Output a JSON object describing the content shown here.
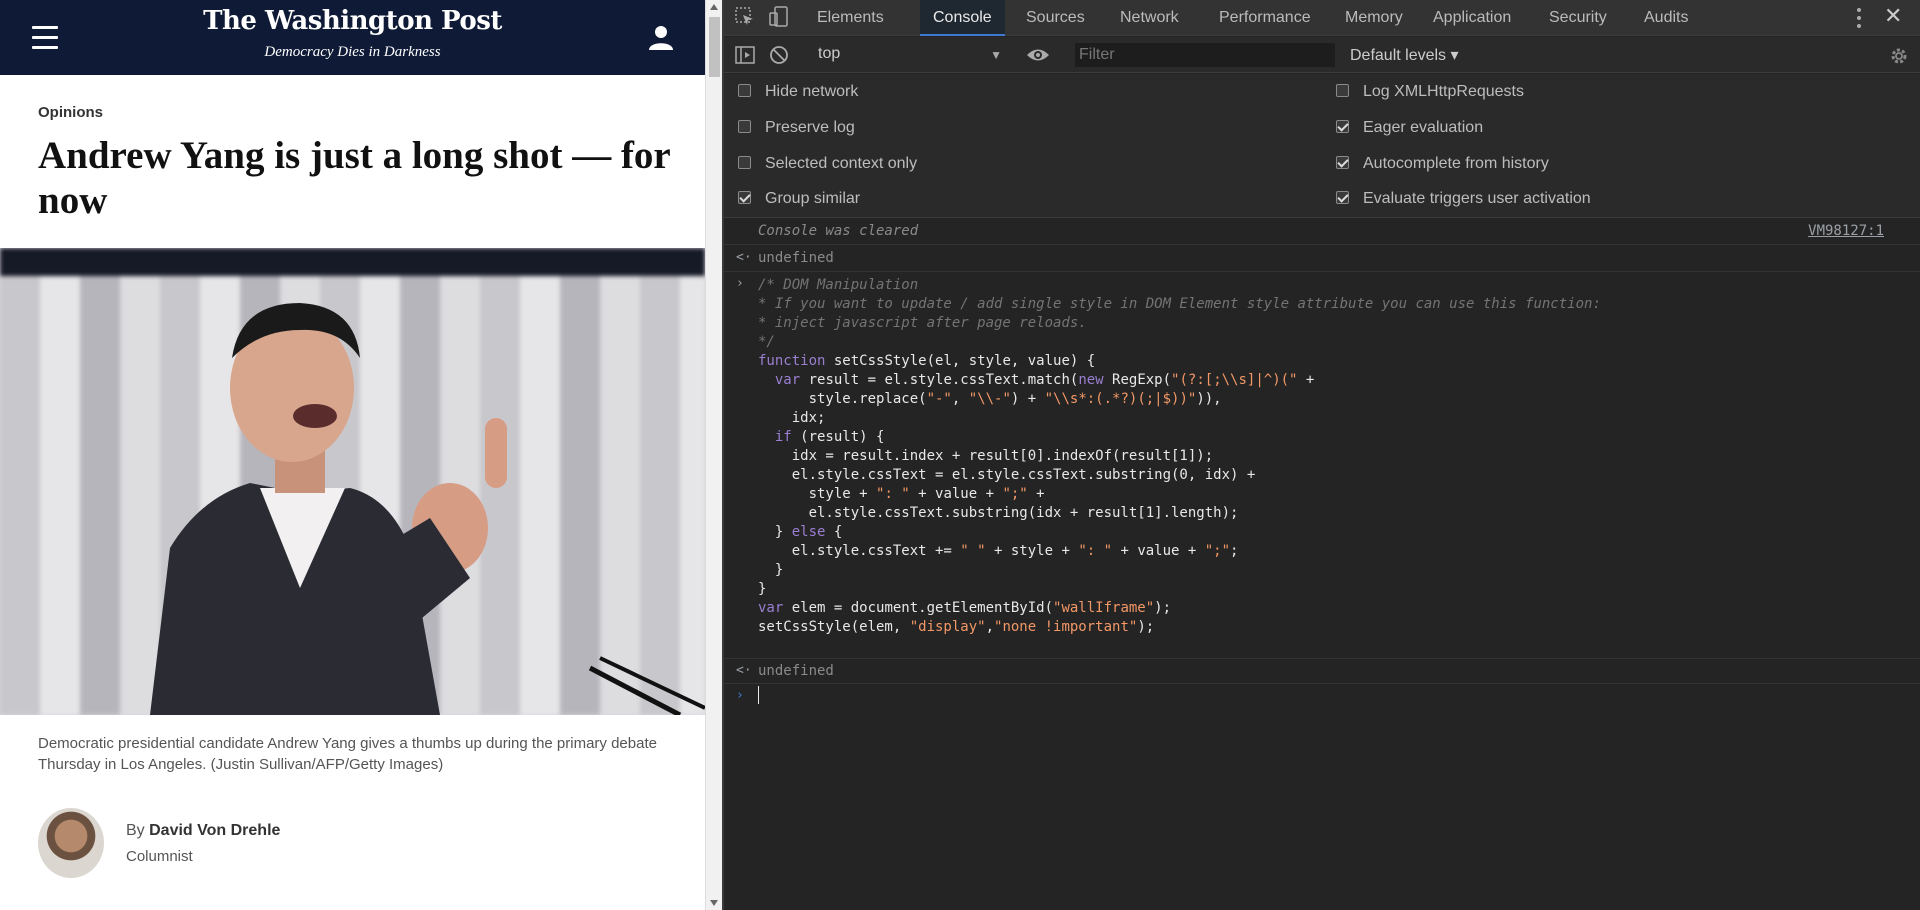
{
  "article": {
    "logo": "The Washington Post",
    "tagline": "Democracy Dies in Darkness",
    "section": "Opinions",
    "headline": "Andrew Yang is just a long shot — for now",
    "caption": "Democratic presidential candidate Andrew Yang gives a thumbs up during the primary debate Thursday in Los Angeles. (Justin Sullivan/AFP/Getty Images)",
    "byline_prefix": "By",
    "author": "David Von Drehle",
    "author_role": "Columnist"
  },
  "devtools": {
    "tabs": [
      "Elements",
      "Console",
      "Sources",
      "Network",
      "Performance",
      "Memory",
      "Application",
      "Security",
      "Audits"
    ],
    "active_tab": "Console",
    "context": "top",
    "filter_placeholder": "Filter",
    "levels": "Default levels ▾",
    "settings": {
      "left": [
        {
          "label": "Hide network",
          "checked": false
        },
        {
          "label": "Preserve log",
          "checked": false
        },
        {
          "label": "Selected context only",
          "checked": false
        },
        {
          "label": "Group similar",
          "checked": true
        }
      ],
      "right": [
        {
          "label": "Log XMLHttpRequests",
          "checked": false
        },
        {
          "label": "Eager evaluation",
          "checked": true
        },
        {
          "label": "Autocomplete from history",
          "checked": true
        },
        {
          "label": "Evaluate triggers user activation",
          "checked": true
        }
      ]
    },
    "console": {
      "cleared": "Console was cleared",
      "source_link": "VM98127:1",
      "result1": "undefined",
      "code_lines": [
        "/* DOM Manipulation",
        "* If you want to update / add single style in DOM Element style attribute you can use this function:",
        "* inject javascript after page reloads.",
        "*/",
        "function setCssStyle(el, style, value) {",
        "  var result = el.style.cssText.match(new RegExp(\"(?:[;\\\\s]|^)(\" +",
        "      style.replace(\"-\", \"\\\\-\") + \"\\\\s*:(.*?)(;|$))\")),",
        "    idx;",
        "  if (result) {",
        "    idx = result.index + result[0].indexOf(result[1]);",
        "    el.style.cssText = el.style.cssText.substring(0, idx) +",
        "      style + \": \" + value + \";\" +",
        "      el.style.cssText.substring(idx + result[1].length);",
        "  } else {",
        "    el.style.cssText += \" \" + style + \": \" + value + \";\";",
        "  }",
        "}",
        "var elem = document.getElementById(\"wallIframe\");",
        "setCssStyle(elem, \"display\",\"none !important\");"
      ],
      "result2": "undefined"
    }
  }
}
